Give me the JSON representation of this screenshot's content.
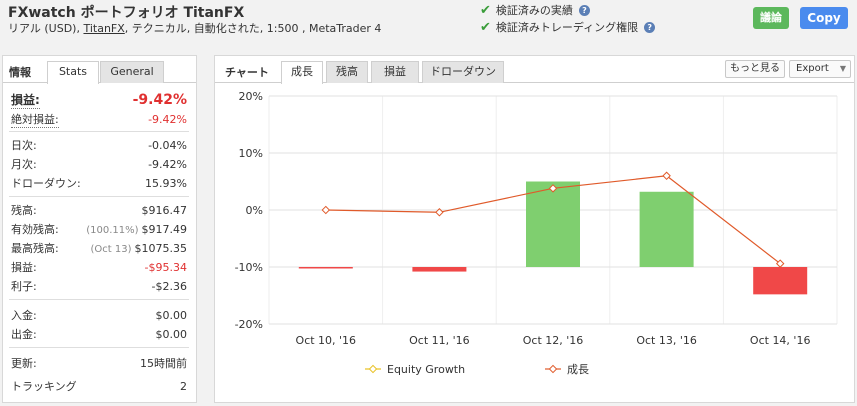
{
  "header": {
    "title": "FXwatch ポートフォリオ TitanFX",
    "subtitle_pre": "リアル (USD), ",
    "subtitle_link": "TitanFX",
    "subtitle_post": ", テクニカル, 自動化された, 1:500 , MetaTrader 4",
    "verified_record": "検証済みの実績",
    "verified_trading": "検証済みトレーディング権限",
    "help_glyph": "?",
    "btn_green": "議論",
    "btn_copy": "Copy"
  },
  "left": {
    "tab_label": "情報",
    "tabs": [
      "Stats",
      "General"
    ],
    "rows": [
      {
        "label": "損益:",
        "value": "-9.42%"
      },
      {
        "label": "絶対損益:",
        "value": "-9.42%"
      },
      {
        "label": "日次:",
        "value": "-0.04%"
      },
      {
        "label": "月次:",
        "value": "-9.42%"
      },
      {
        "label": "ドローダウン:",
        "value": "15.93%"
      },
      {
        "label": "残高:",
        "value": "$916.47"
      },
      {
        "label": "有効残高:",
        "pre": "(100.11%)",
        "value": "$917.49"
      },
      {
        "label": "最高残高:",
        "pre": "(Oct 13)",
        "value": "$1075.35"
      },
      {
        "label": "損益:",
        "value": "-$95.34"
      },
      {
        "label": "利子:",
        "value": "-$2.36"
      },
      {
        "label": "入金:",
        "value": "$0.00"
      },
      {
        "label": "出金:",
        "value": "$0.00"
      },
      {
        "label": "更新:",
        "value": "15時間前"
      },
      {
        "label": "トラッキング",
        "value": "2"
      }
    ]
  },
  "right": {
    "tab_label": "チャート",
    "tabs": [
      "成長",
      "残高",
      "損益",
      "ドローダウン"
    ],
    "more_button": "もっと見る",
    "export_button": "Export",
    "export_arrow": "▼"
  },
  "chart_data": {
    "type": "bar",
    "categories": [
      "Oct 10, '16",
      "Oct 11, '16",
      "Oct 12, '16",
      "Oct 13, '16",
      "Oct 14, '16"
    ],
    "ylim": [
      -20,
      20
    ],
    "yticks": [
      -20,
      -10,
      0,
      10,
      20
    ],
    "ytick_labels": [
      "-20%",
      "-10%",
      "0%",
      "10%",
      "20%"
    ],
    "bar_baseline": -10,
    "bars": [
      {
        "value": -10.2,
        "color": "#f04848"
      },
      {
        "value": -10.8,
        "color": "#f04848"
      },
      {
        "value": 5.0,
        "color": "#7fcf6f"
      },
      {
        "value": 3.2,
        "color": "#7fcf6f"
      },
      {
        "value": -14.8,
        "color": "#f04848"
      }
    ],
    "series": [
      {
        "name": "Equity Growth",
        "color": "#e8c020",
        "values": []
      },
      {
        "name": "成長",
        "color": "#e05a2a",
        "values": [
          0.0,
          -0.4,
          3.8,
          6.0,
          -9.4
        ]
      }
    ],
    "legend_position": "bottom",
    "grid": true
  }
}
